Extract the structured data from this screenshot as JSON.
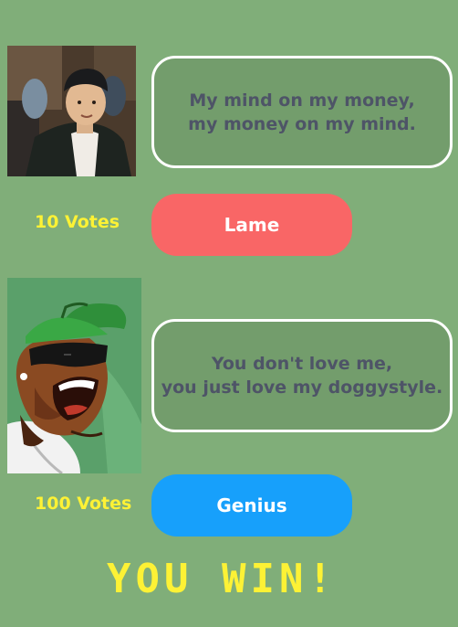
{
  "contest": {
    "top": {
      "avatar": "photo-portrait-man-in-beanie",
      "quote_lines": [
        "My mind on my money,",
        "my money on my mind."
      ],
      "votes_label": "10 Votes",
      "button_label": "Lame",
      "button_color": "#f96666"
    },
    "bottom": {
      "avatar": "cartoon-portrait-man-green-cap-sunglasses",
      "quote_lines": [
        "You don't love me,",
        "you just love my doggystyle."
      ],
      "votes_label": "100 Votes",
      "button_label": "Genius",
      "button_color": "#17a0fb"
    },
    "result": "YOU WIN!"
  },
  "colors": {
    "background": "#80ae79",
    "bubble_fill": "#739d6c",
    "bubble_border": "#ffffff",
    "quote_text": "#4e5467",
    "accent_yellow": "#fdf235"
  }
}
